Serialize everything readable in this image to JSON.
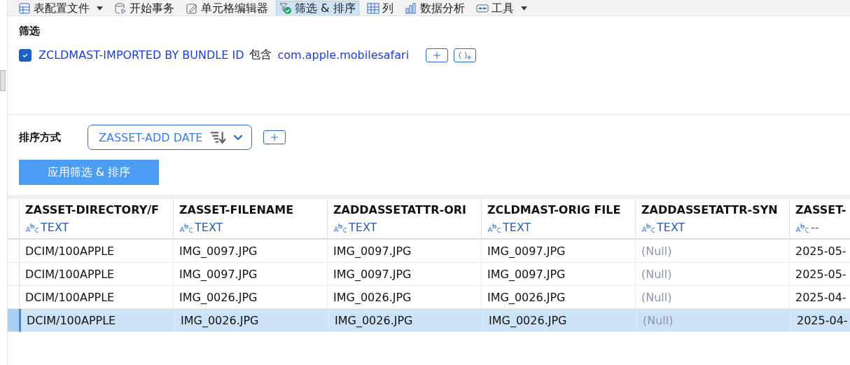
{
  "toolbar": [
    {
      "label": "表配置文件",
      "dropdown": true,
      "selected": false
    },
    {
      "label": "开始事务",
      "dropdown": false,
      "selected": false
    },
    {
      "label": "单元格编辑器",
      "dropdown": false,
      "selected": false
    },
    {
      "label": "筛选 & 排序",
      "dropdown": false,
      "selected": true
    },
    {
      "label": "列",
      "dropdown": false,
      "selected": false
    },
    {
      "label": "数据分析",
      "dropdown": false,
      "selected": false
    },
    {
      "label": "工具",
      "dropdown": true,
      "selected": false
    }
  ],
  "filter": {
    "title": "筛选",
    "conditions": [
      {
        "checked": true,
        "field": "ZCLDMAST-IMPORTED BY BUNDLE ID",
        "operator": "包含",
        "value": "com.apple.mobilesafari"
      }
    ]
  },
  "sort": {
    "title": "排序方式",
    "fields": [
      {
        "field": "ZASSET-ADD DATE"
      }
    ]
  },
  "apply_button": "应用筛选 & 排序",
  "table": {
    "columns": [
      {
        "name": "ZASSET-DIRECTORY/F",
        "type": "TEXT"
      },
      {
        "name": "ZASSET-FILENAME",
        "type": "TEXT"
      },
      {
        "name": "ZADDASSETATTR-ORI",
        "type": "TEXT"
      },
      {
        "name": "ZCLDMAST-ORIG FILE",
        "type": "TEXT"
      },
      {
        "name": "ZADDASSETATTR-SYN",
        "type": "TEXT"
      },
      {
        "name": "ZASSET-",
        "type": "--"
      }
    ],
    "rows": [
      {
        "selected": false,
        "cells": [
          {
            "text": "DCIM/100APPLE",
            "kind": "value"
          },
          {
            "text": "IMG_0097.JPG",
            "kind": "value"
          },
          {
            "text": "IMG_0097.JPG",
            "kind": "value"
          },
          {
            "text": "IMG_0097.JPG",
            "kind": "value"
          },
          {
            "text": "(Null)",
            "kind": "null"
          },
          {
            "text": "2025-05-",
            "kind": "value"
          }
        ]
      },
      {
        "selected": false,
        "cells": [
          {
            "text": "DCIM/100APPLE",
            "kind": "value"
          },
          {
            "text": "IMG_0097.JPG",
            "kind": "value"
          },
          {
            "text": "IMG_0097.JPG",
            "kind": "value"
          },
          {
            "text": "IMG_0097.JPG",
            "kind": "value"
          },
          {
            "text": "(Null)",
            "kind": "null"
          },
          {
            "text": "2025-05-",
            "kind": "value"
          }
        ]
      },
      {
        "selected": false,
        "cells": [
          {
            "text": "DCIM/100APPLE",
            "kind": "value"
          },
          {
            "text": "IMG_0026.JPG",
            "kind": "value"
          },
          {
            "text": "IMG_0026.JPG",
            "kind": "value"
          },
          {
            "text": "IMG_0026.JPG",
            "kind": "value"
          },
          {
            "text": "(Null)",
            "kind": "null"
          },
          {
            "text": "2025-04-",
            "kind": "value"
          }
        ]
      },
      {
        "selected": true,
        "cells": [
          {
            "text": "DCIM/100APPLE",
            "kind": "value"
          },
          {
            "text": "IMG_0026.JPG",
            "kind": "value"
          },
          {
            "text": "IMG_0026.JPG",
            "kind": "value"
          },
          {
            "text": "IMG_0026.JPG",
            "kind": "value"
          },
          {
            "text": "(Null)",
            "kind": "null"
          },
          {
            "text": "2025-04-",
            "kind": "value"
          }
        ]
      }
    ]
  }
}
